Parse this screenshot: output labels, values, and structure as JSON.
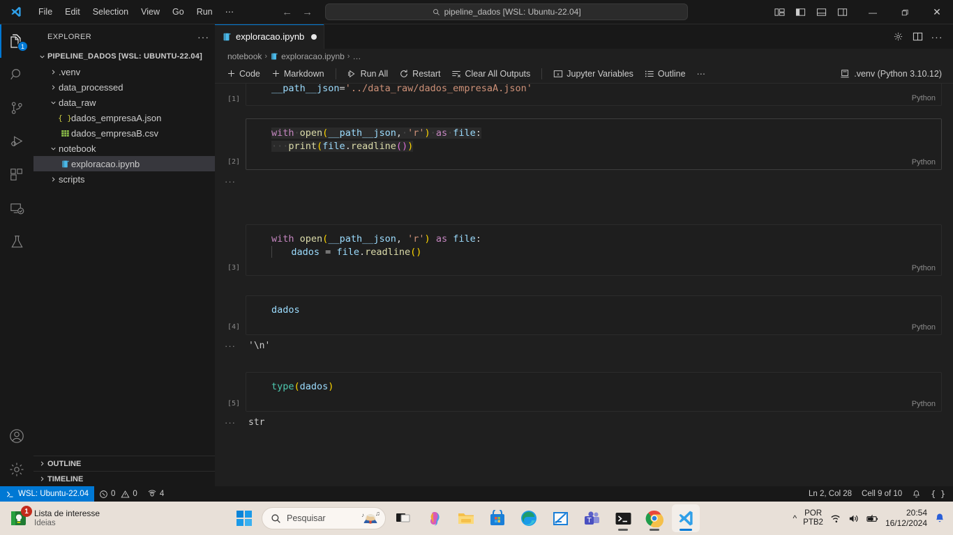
{
  "titlebar": {
    "menus": [
      "File",
      "Edit",
      "Selection",
      "View",
      "Go",
      "Run",
      "⋯"
    ],
    "back_icon": "arrow-left-icon",
    "forward_icon": "arrow-right-icon",
    "command_center": {
      "text": "pipeline_dados [WSL: Ubuntu-22.04]",
      "icon": "search-icon"
    },
    "layout_icons": [
      "customize-layout-icon",
      "toggle-primary-sidebar-icon",
      "toggle-panel-icon",
      "toggle-secondary-sidebar-icon"
    ],
    "window_controls": {
      "minimize": "—",
      "maximize": "❑",
      "close": "✕"
    }
  },
  "activitybar": {
    "items": [
      {
        "name": "explorer",
        "icon": "files-icon",
        "badge": "1",
        "active": true
      },
      {
        "name": "search",
        "icon": "search-icon",
        "badge": "",
        "active": false
      },
      {
        "name": "source-control",
        "icon": "source-control-icon",
        "badge": "",
        "active": false
      },
      {
        "name": "run-and-debug",
        "icon": "run-debug-icon",
        "badge": "",
        "active": false
      },
      {
        "name": "extensions",
        "icon": "extensions-icon",
        "badge": "",
        "active": false
      },
      {
        "name": "remote-explorer",
        "icon": "remote-explorer-icon",
        "badge": "",
        "active": false
      },
      {
        "name": "testing",
        "icon": "beaker-icon",
        "badge": "",
        "active": false
      }
    ],
    "bottom": [
      {
        "name": "accounts",
        "icon": "account-icon"
      },
      {
        "name": "manage",
        "icon": "gear-icon"
      }
    ]
  },
  "sidebar": {
    "title": "EXPLORER",
    "more_actions": "···",
    "root": {
      "label": "PIPELINE_DADOS [WSL: UBUNTU-22.04]",
      "expanded": true
    },
    "tree": [
      {
        "label": ".venv",
        "type": "folder",
        "expanded": false,
        "indent": 1,
        "icon": "chevron-right-icon"
      },
      {
        "label": "data_processed",
        "type": "folder",
        "expanded": false,
        "indent": 1,
        "icon": "chevron-right-icon"
      },
      {
        "label": "data_raw",
        "type": "folder",
        "expanded": true,
        "indent": 1,
        "icon": "chevron-down-icon"
      },
      {
        "label": "dados_empresaA.json",
        "type": "json",
        "indent": 2,
        "icon": "json-file-icon"
      },
      {
        "label": "dados_empresaB.csv",
        "type": "csv",
        "indent": 2,
        "icon": "csv-file-icon"
      },
      {
        "label": "notebook",
        "type": "folder",
        "expanded": true,
        "indent": 1,
        "icon": "chevron-down-icon"
      },
      {
        "label": "exploracao.ipynb",
        "type": "ipynb",
        "indent": 2,
        "icon": "notebook-file-icon",
        "selected": true
      },
      {
        "label": "scripts",
        "type": "folder",
        "expanded": false,
        "indent": 1,
        "icon": "chevron-right-icon"
      }
    ],
    "panels": [
      {
        "label": "OUTLINE",
        "expanded": false
      },
      {
        "label": "TIMELINE",
        "expanded": false
      }
    ]
  },
  "editor": {
    "tab": {
      "label": "exploracao.ipynb",
      "icon": "notebook-file-icon",
      "dirty": true
    },
    "tab_actions": [
      "settings-gear-icon",
      "split-editor-icon",
      "more-actions-icon"
    ],
    "breadcrumbs": [
      "notebook",
      "exploracao.ipynb",
      "…"
    ],
    "toolbar": [
      {
        "label": "Code",
        "icon": "plus-icon"
      },
      {
        "label": "Markdown",
        "icon": "plus-icon"
      },
      {
        "label": "Run All",
        "icon": "run-all-icon"
      },
      {
        "label": "Restart",
        "icon": "restart-icon"
      },
      {
        "label": "Clear All Outputs",
        "icon": "clear-outputs-icon"
      },
      {
        "label": "Jupyter Variables",
        "icon": "variables-icon"
      },
      {
        "label": "Outline",
        "icon": "outline-icon"
      },
      {
        "label": "···",
        "icon": "more-actions-icon"
      }
    ],
    "kernel": {
      "label": ".venv (Python 3.10.12)",
      "icon": "kernel-icon"
    },
    "cells": [
      {
        "exec": "[1]",
        "language": "Python",
        "lines": [
          "__path__json='../data_raw/dados_empresaA.json'"
        ],
        "output": null
      },
      {
        "exec": "[2]",
        "language": "Python",
        "lines": [
          "with open(__path__json, 'r') as file:",
          "    print(file.readline())"
        ],
        "output": {
          "text": "",
          "prefix": "···"
        }
      },
      {
        "exec": "[3]",
        "language": "Python",
        "lines": [
          "with open(__path__json, 'r') as file:",
          "    dados = file.readline()"
        ],
        "output": null
      },
      {
        "exec": "[4]",
        "language": "Python",
        "lines": [
          "dados"
        ],
        "output": {
          "text": "'\\n'",
          "prefix": "···"
        }
      },
      {
        "exec": "[5]",
        "language": "Python",
        "lines": [
          "type(dados)"
        ],
        "output": {
          "text": "str",
          "prefix": "···"
        }
      }
    ]
  },
  "statusbar": {
    "remote": {
      "label": "WSL: Ubuntu-22.04",
      "icon": "remote-icon"
    },
    "problems": {
      "errors": "0",
      "warnings": "0",
      "error_icon": "error-circle-icon",
      "warning_icon": "warning-triangle-icon"
    },
    "ports": {
      "count": "4",
      "icon": "ports-icon"
    },
    "right": [
      {
        "name": "cursor-position",
        "label": "Ln 2, Col 28"
      },
      {
        "name": "cell-position",
        "label": "Cell 9 of 10"
      },
      {
        "name": "notifications",
        "label": "",
        "icon": "bell-icon"
      },
      {
        "name": "format-braces",
        "label": "{ }"
      }
    ]
  },
  "taskbar": {
    "widget": {
      "title": "Lista de interesse",
      "subtitle": "Ideias",
      "badge": "1",
      "icon": "notes-widget-icon"
    },
    "start_icon": "windows-start-icon",
    "search": {
      "placeholder": "Pesquisar",
      "icon": "search-icon",
      "avatar": "composer-avatar-icon"
    },
    "apps": [
      {
        "name": "task-view",
        "icon": "task-view-icon"
      },
      {
        "name": "copilot",
        "icon": "copilot-icon"
      },
      {
        "name": "file-explorer",
        "icon": "folder-icon"
      },
      {
        "name": "microsoft-store",
        "icon": "store-icon"
      },
      {
        "name": "microsoft-edge",
        "icon": "edge-icon"
      },
      {
        "name": "snipping-tool",
        "icon": "snipping-tool-icon"
      },
      {
        "name": "microsoft-teams",
        "icon": "teams-icon"
      },
      {
        "name": "terminal",
        "icon": "terminal-icon",
        "running": true
      },
      {
        "name": "google-chrome",
        "icon": "chrome-icon",
        "running": true
      },
      {
        "name": "visual-studio-code",
        "icon": "vscode-icon",
        "active": true
      }
    ],
    "tray": {
      "chevron": "chevron-up-icon",
      "language_line1": "POR",
      "language_line2": "PTB2",
      "wifi_icon": "wifi-icon",
      "volume_icon": "volume-icon",
      "battery_icon": "battery-icon",
      "time": "20:54",
      "date": "16/12/2024",
      "notification_icon": "bell-icon"
    }
  }
}
